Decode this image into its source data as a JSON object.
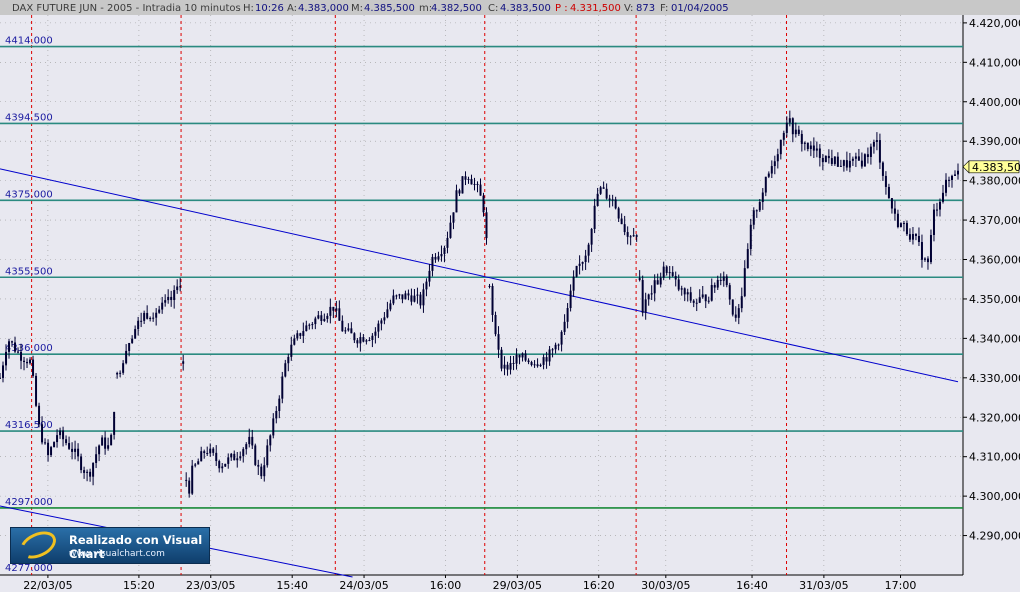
{
  "header": {
    "instrument": "DAX FUTURE  JUN - 2005 - Intradia 10 minutos",
    "h_label": "H:",
    "h_value": "10:26",
    "a_label": "A:",
    "a_value": "4.383,000",
    "m_label": "M:",
    "m_value": "4.385,500",
    "mn_label": "m:",
    "mn_value": "4.382,500",
    "c_label": "C:",
    "c_value": "4.383,500",
    "p_label": "P :",
    "p_value": "4.331,500",
    "v_label": "V:",
    "v_value": "873",
    "f_label": "F:",
    "f_value": "01/04/2005"
  },
  "logo": {
    "title": "Realizado con Visual Chart",
    "url": "www.visualchart.com"
  },
  "colors": {
    "background": "#e8e8f0",
    "candles": "#000033",
    "levels": "#2a8a80",
    "trendlines": "#0000cc",
    "separators": "#dd0000",
    "grid": "#9a9a9a"
  },
  "chart_data": {
    "type": "candlestick",
    "ylim": [
      4280,
      4422
    ],
    "yticks": [
      4290,
      4300,
      4310,
      4320,
      4330,
      4340,
      4350,
      4360,
      4370,
      4380,
      4390,
      4400,
      4410,
      4420
    ],
    "ytick_labels": [
      "4.290,000",
      "4.300,000",
      "4.310,000",
      "4.320,000",
      "4.330,000",
      "4.340,000",
      "4.350,000",
      "4.360,000",
      "4.370,000",
      "4.380,000",
      "4.390,000",
      "4.400,000",
      "4.410,000",
      "4.420,000"
    ],
    "current_value": 4383.5,
    "current_label": "4.383,50",
    "x_labels": [
      {
        "label": "22/03/05",
        "pos": 0.05
      },
      {
        "label": "15:20",
        "pos": 0.145
      },
      {
        "label": "23/03/05",
        "pos": 0.22
      },
      {
        "label": "15:40",
        "pos": 0.305
      },
      {
        "label": "24/03/05",
        "pos": 0.38
      },
      {
        "label": "16:00",
        "pos": 0.465
      },
      {
        "label": "29/03/05",
        "pos": 0.54
      },
      {
        "label": "16:20",
        "pos": 0.625
      },
      {
        "label": "30/03/05",
        "pos": 0.695
      },
      {
        "label": "16:40",
        "pos": 0.785
      },
      {
        "label": "31/03/05",
        "pos": 0.86
      },
      {
        "label": "17:00",
        "pos": 0.94
      }
    ],
    "day_separators": [
      0.033,
      0.189,
      0.35,
      0.506,
      0.664,
      0.821
    ],
    "levels": [
      {
        "value": 4414.0,
        "label": "4414.000"
      },
      {
        "value": 4394.5,
        "label": "4394.500"
      },
      {
        "value": 4375.0,
        "label": "4375.000"
      },
      {
        "value": 4355.5,
        "label": "4355.500"
      },
      {
        "value": 4336.0,
        "label": "4336.000"
      },
      {
        "value": 4316.5,
        "label": "4316.500"
      },
      {
        "value": 4297.0,
        "label": "4297.000",
        "color": "#1a8a3a"
      },
      {
        "value": 4277.0,
        "label": "4277.000"
      }
    ],
    "trendlines": [
      {
        "from": [
          0.0,
          4383.0
        ],
        "to": [
          1.0,
          4329.0
        ]
      },
      {
        "from": [
          0.0,
          4297.5
        ],
        "to": [
          0.368,
          4279.5
        ]
      }
    ],
    "anchors": [
      [
        0.0,
        4330
      ],
      [
        0.008,
        4340
      ],
      [
        0.02,
        4336
      ],
      [
        0.032,
        4334
      ],
      [
        0.04,
        4318
      ],
      [
        0.05,
        4310
      ],
      [
        0.06,
        4316
      ],
      [
        0.075,
        4312
      ],
      [
        0.092,
        4305
      ],
      [
        0.105,
        4314
      ],
      [
        0.115,
        4312
      ],
      [
        0.122,
        4330
      ],
      [
        0.135,
        4340
      ],
      [
        0.15,
        4346
      ],
      [
        0.165,
        4347
      ],
      [
        0.18,
        4350
      ],
      [
        0.189,
        4355
      ],
      [
        0.195,
        4298
      ],
      [
        0.2,
        4306
      ],
      [
        0.215,
        4312
      ],
      [
        0.23,
        4308
      ],
      [
        0.245,
        4310
      ],
      [
        0.26,
        4314
      ],
      [
        0.272,
        4305
      ],
      [
        0.285,
        4318
      ],
      [
        0.3,
        4336
      ],
      [
        0.315,
        4342
      ],
      [
        0.33,
        4345
      ],
      [
        0.348,
        4348
      ],
      [
        0.358,
        4342
      ],
      [
        0.372,
        4340
      ],
      [
        0.39,
        4341
      ],
      [
        0.41,
        4350
      ],
      [
        0.428,
        4351
      ],
      [
        0.44,
        4349
      ],
      [
        0.45,
        4360
      ],
      [
        0.465,
        4364
      ],
      [
        0.477,
        4377
      ],
      [
        0.488,
        4382
      ],
      [
        0.5,
        4377
      ],
      [
        0.506,
        4372
      ],
      [
        0.512,
        4348
      ],
      [
        0.525,
        4332
      ],
      [
        0.54,
        4335
      ],
      [
        0.56,
        4334
      ],
      [
        0.575,
        4336
      ],
      [
        0.588,
        4342
      ],
      [
        0.6,
        4356
      ],
      [
        0.612,
        4362
      ],
      [
        0.625,
        4378
      ],
      [
        0.64,
        4375
      ],
      [
        0.655,
        4366
      ],
      [
        0.664,
        4368
      ],
      [
        0.67,
        4347
      ],
      [
        0.68,
        4352
      ],
      [
        0.695,
        4358
      ],
      [
        0.71,
        4352
      ],
      [
        0.725,
        4349
      ],
      [
        0.74,
        4351
      ],
      [
        0.755,
        4357
      ],
      [
        0.767,
        4345
      ],
      [
        0.775,
        4352
      ],
      [
        0.785,
        4370
      ],
      [
        0.8,
        4380
      ],
      [
        0.815,
        4390
      ],
      [
        0.821,
        4396
      ],
      [
        0.83,
        4392
      ],
      [
        0.845,
        4388
      ],
      [
        0.86,
        4386
      ],
      [
        0.88,
        4384
      ],
      [
        0.9,
        4385
      ],
      [
        0.915,
        4390
      ],
      [
        0.925,
        4378
      ],
      [
        0.935,
        4370
      ],
      [
        0.945,
        4368
      ],
      [
        0.958,
        4364
      ],
      [
        0.968,
        4358
      ],
      [
        0.975,
        4372
      ],
      [
        0.985,
        4378
      ],
      [
        1.0,
        4383.5
      ]
    ]
  }
}
